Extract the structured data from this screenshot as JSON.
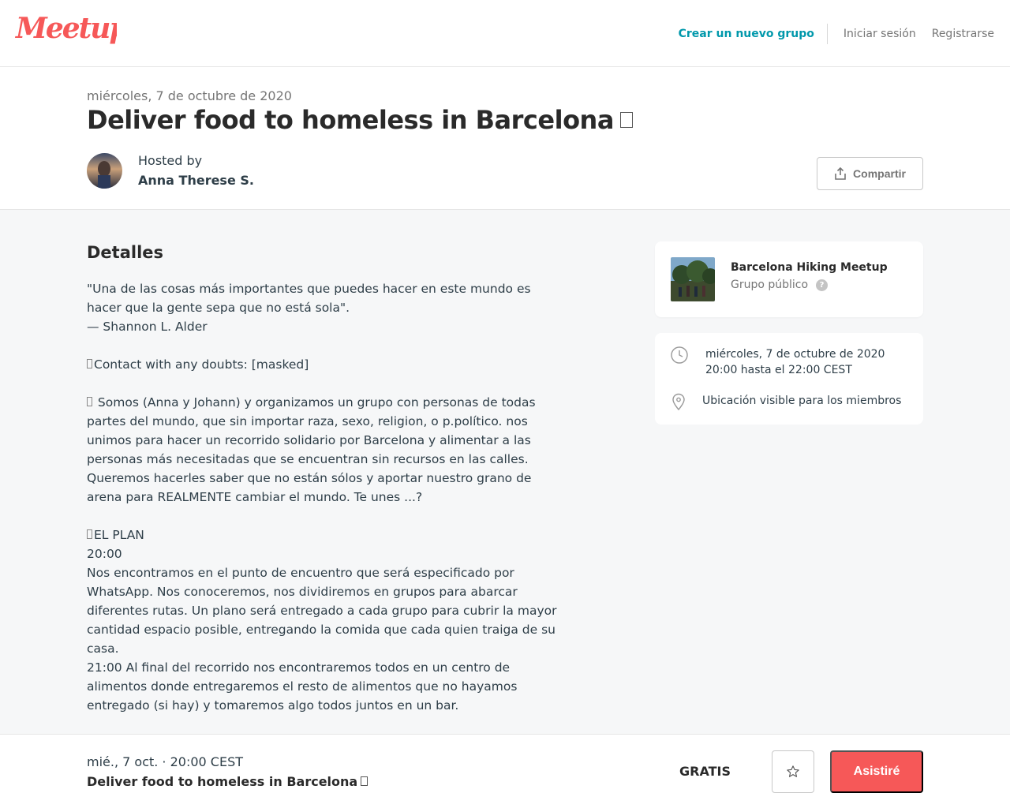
{
  "nav": {
    "logo_text": "Meetup",
    "create_group": "Crear un nuevo grupo",
    "login": "Iniciar sesión",
    "register": "Registrarse"
  },
  "event": {
    "date": "miércoles, 7 de octubre de 2020",
    "title": "Deliver food to homeless in Barcelona",
    "hosted_by_label": "Hosted by",
    "host_name": "Anna Therese S.",
    "share_label": "Compartir"
  },
  "details": {
    "heading": "Detalles",
    "paragraphs": [
      "\"Una de las cosas más importantes que puedes hacer en este mundo es hacer que la gente sepa que no está sola\".\n— Shannon L. Alder",
      "Contact with any doubts: [masked]",
      " Somos (Anna y Johann) y organizamos un grupo con personas de todas partes del mundo, que sin importar raza, sexo, religion, o p.político. nos unimos para hacer un recorrido solidario por Barcelona y alimentar a las personas más necesitadas que se encuentran sin recursos en las calles. Queremos hacerles saber que no están sólos y aportar nuestro grano de arena para REALMENTE cambiar el mundo. Te unes ...?",
      "EL PLAN\n20:00\nNos encontramos en el punto de encuentro que será especificado por WhatsApp. Nos conoceremos, nos dividiremos en grupos para abarcar diferentes rutas. Un plano será entregado a cada grupo para cubrir la mayor cantidad espacio posible, entregando la comida que cada quien traiga de su casa.\n21:00 Al final del recorrido nos encontraremos todos en un centro de alimentos donde entregaremos el resto de alimentos que no hayamos entregado (si hay) y tomaremos algo todos juntos en un bar."
    ]
  },
  "group": {
    "name": "Barcelona Hiking Meetup",
    "type": "Grupo público",
    "help": "?"
  },
  "info": {
    "date_line1": "miércoles, 7 de octubre de 2020",
    "date_line2": "20:00 hasta el 22:00 CEST",
    "location": "Ubicación visible para los miembros"
  },
  "bottom": {
    "date": "mié., 7 oct. · 20:00 CEST",
    "title": "Deliver food to homeless in Barcelona",
    "price": "GRATIS",
    "attend": "Asistiré"
  },
  "colors": {
    "brand": "#f65858",
    "link": "#0098ab",
    "background": "#f6f7f8"
  },
  "icons": [
    "meetup-logo",
    "share-icon",
    "help-icon",
    "clock-icon",
    "location-pin-icon",
    "star-icon"
  ]
}
